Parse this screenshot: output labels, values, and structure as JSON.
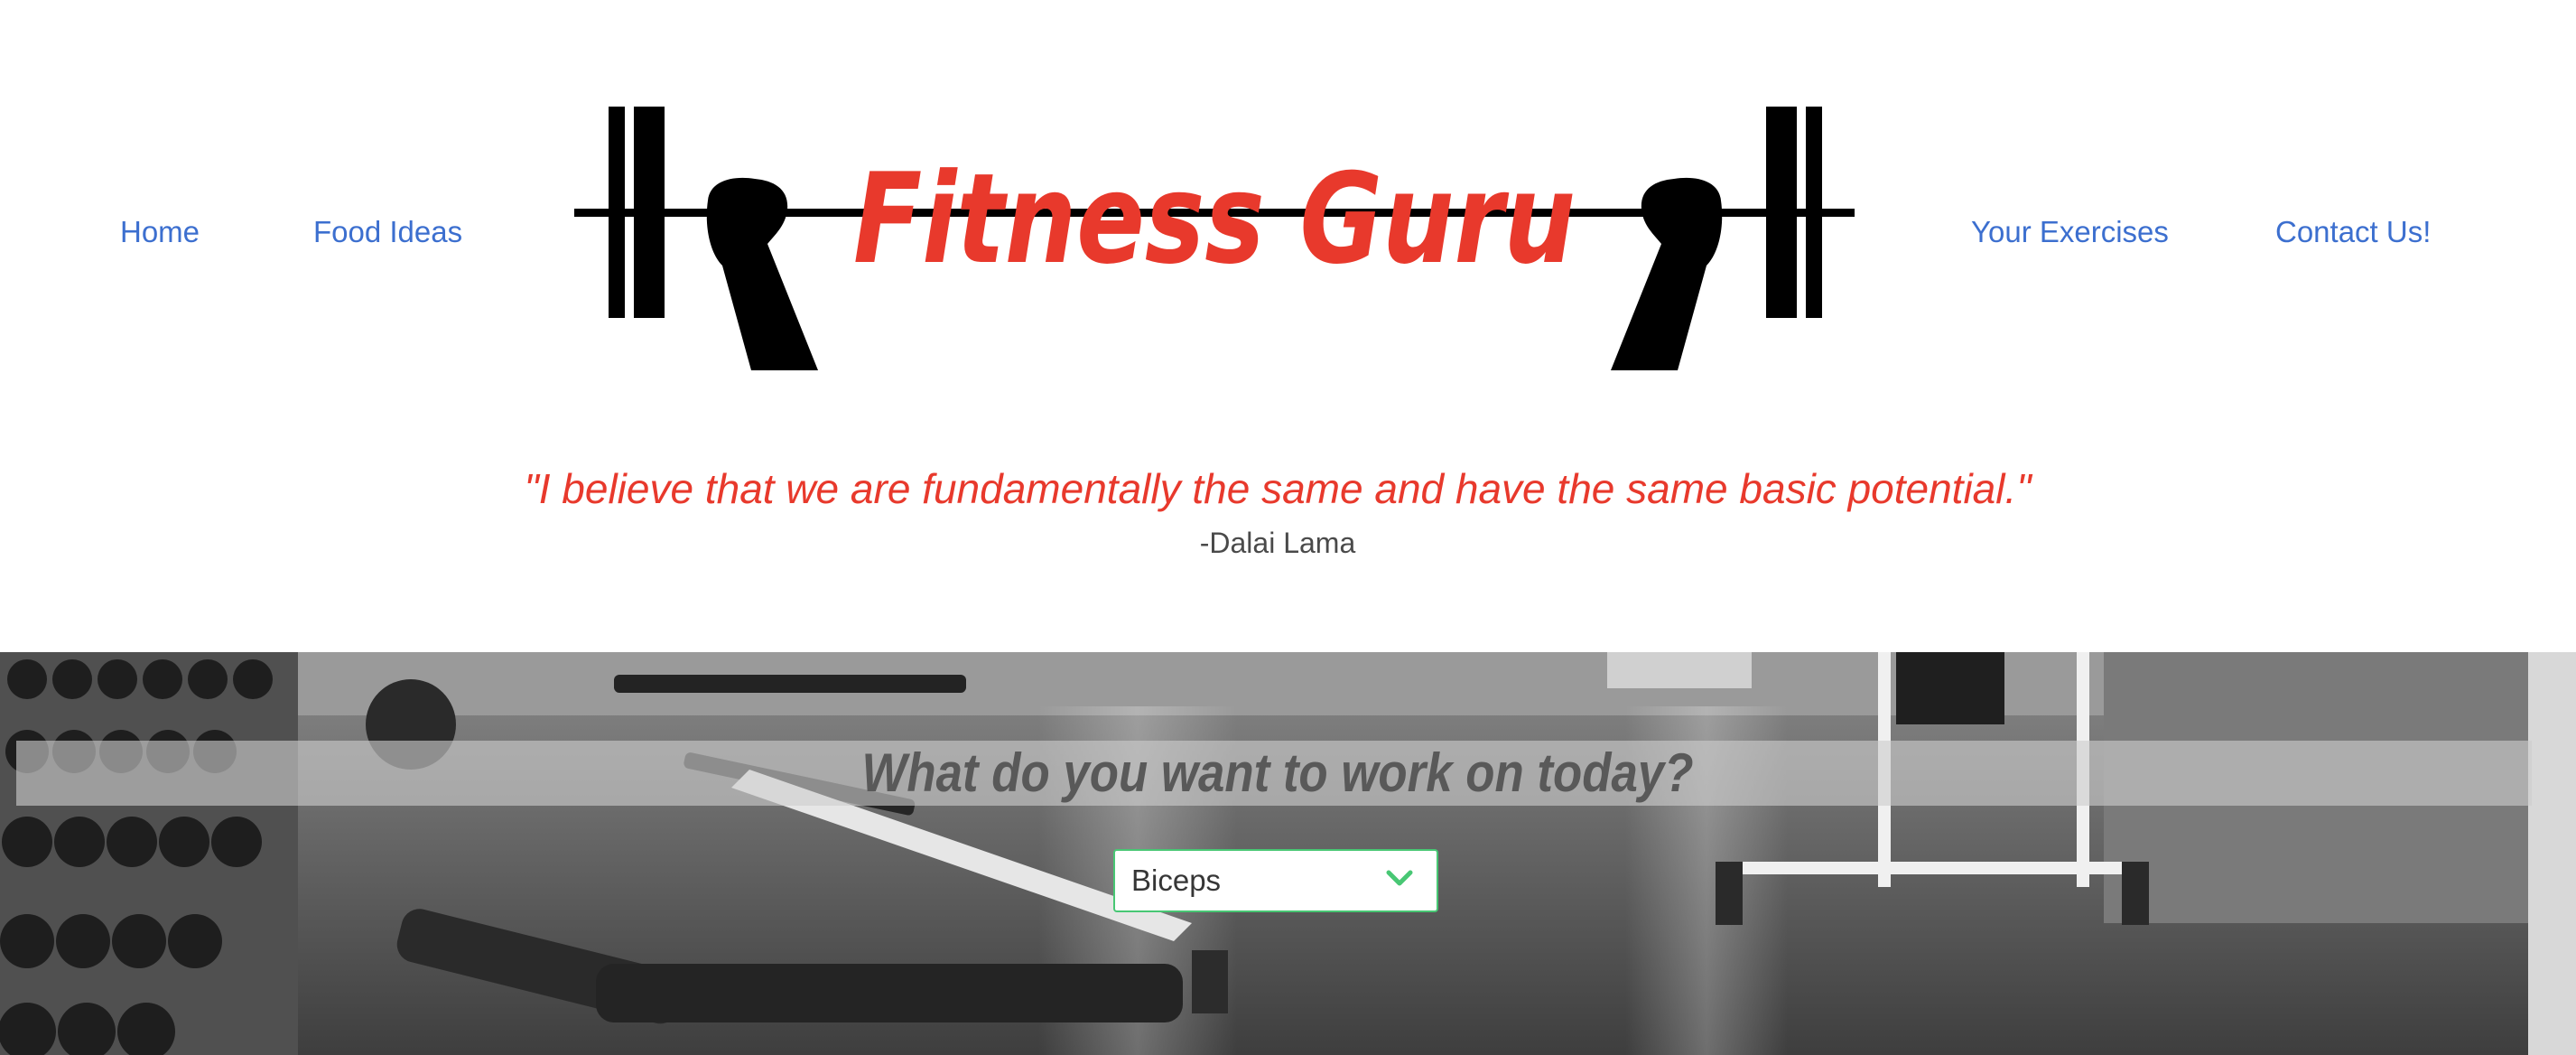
{
  "nav": {
    "home": "Home",
    "food_ideas": "Food Ideas",
    "your_exercises": "Your Exercises",
    "contact_us": "Contact Us!"
  },
  "logo": {
    "text": "Fitness Guru",
    "icon": "barbell-fists-logo",
    "color_text": "#e8392c",
    "color_ink": "#000000"
  },
  "quote": {
    "text": "\"I believe that we are fundamentally the same and have the same basic potential.\"",
    "author": "-Dalai Lama",
    "color": "#e8392c"
  },
  "hero": {
    "background": "gym-photo",
    "heading": "What do you want to work on today?",
    "select": {
      "selected": "Biceps",
      "arrow_icon": "chevron-down-icon",
      "border_color": "#48c774"
    }
  },
  "colors": {
    "link": "#3c6fcf",
    "author": "#4a4a4a"
  }
}
